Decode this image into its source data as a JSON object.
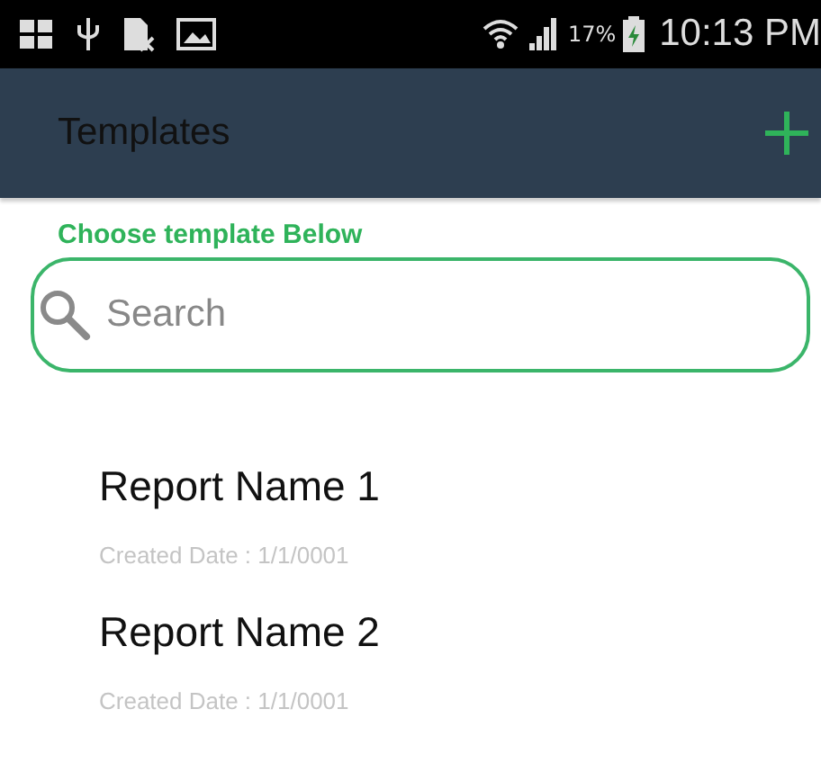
{
  "status_bar": {
    "battery_percent": "17%",
    "time": "10:13 PM"
  },
  "app_bar": {
    "title": "Templates"
  },
  "prompt": "Choose template Below",
  "search": {
    "placeholder": "Search"
  },
  "templates": [
    {
      "name": "Report Name 1",
      "created": "Created Date : 1/1/0001"
    },
    {
      "name": "Report Name 2",
      "created": "Created Date : 1/1/0001"
    }
  ]
}
